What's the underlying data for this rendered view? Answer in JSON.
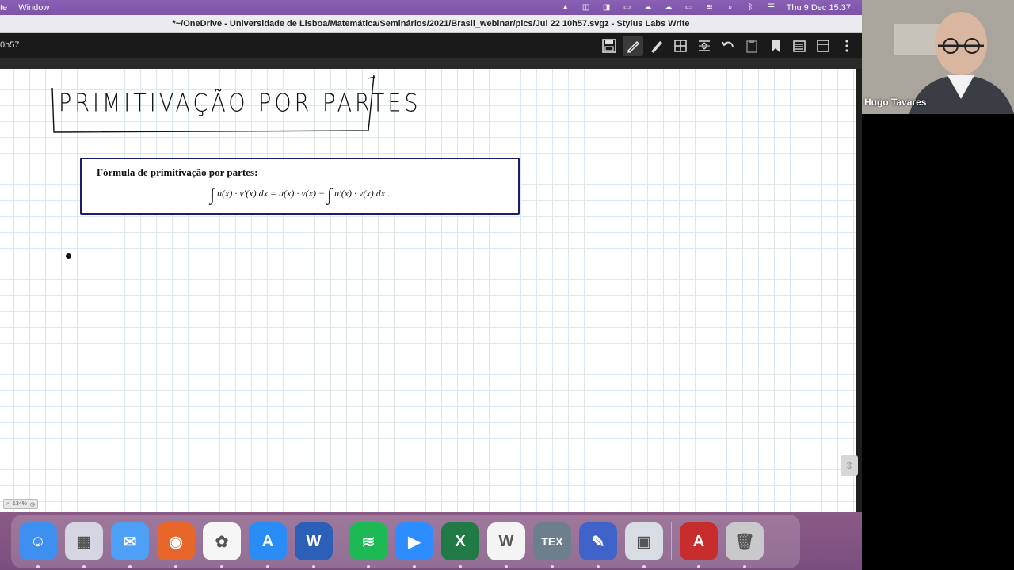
{
  "menubar": {
    "items": [
      "te",
      "Window"
    ],
    "clock": "Thu 9 Dec  15:37"
  },
  "window": {
    "title": "*~/OneDrive - Universidade de Lisboa/Matemática/Seminários/2021/Brasil_webinar/pics/Jul 22 10h57.svgz - Stylus Labs Write"
  },
  "toolbar": {
    "doc_label": "0h57",
    "tools": [
      "save-icon",
      "pen-icon",
      "highlighter-icon",
      "select-icon",
      "insert-space-icon",
      "undo-icon",
      "clipboard-icon",
      "bookmark-icon",
      "document-icon",
      "layout-icon",
      "more-icon"
    ]
  },
  "canvas": {
    "handwritten_title": "PRIMITIVAÇÃO POR PARTES",
    "formula_box": {
      "title": "Fórmula de primitivação por partes:",
      "eq_lhs": "u(x) · v′(x) dx = u(x) · v(x) −",
      "eq_rhs": "u′(x) · v(x) dx ."
    },
    "zoom": "134%"
  },
  "dock": {
    "apps": [
      {
        "name": "Finder",
        "color": "#3e8ff0",
        "glyph": "☺"
      },
      {
        "name": "Launchpad",
        "color": "#d6d6e2",
        "glyph": "▦"
      },
      {
        "name": "Mail",
        "color": "#4da0f5",
        "glyph": "✉"
      },
      {
        "name": "Firefox",
        "color": "#e8662a",
        "glyph": "◉"
      },
      {
        "name": "Photos",
        "color": "#f6f6f6",
        "glyph": "✿"
      },
      {
        "name": "App Store",
        "color": "#2a8cf5",
        "glyph": "A"
      },
      {
        "name": "Word",
        "color": "#2b5fb8",
        "glyph": "W"
      },
      {
        "name": "Spotify",
        "color": "#1db954",
        "glyph": "≋"
      },
      {
        "name": "Zoom",
        "color": "#2d8cff",
        "glyph": "▶"
      },
      {
        "name": "Excel",
        "color": "#1f7a45",
        "glyph": "X"
      },
      {
        "name": "Stylus Labs Write",
        "color": "#f4f4f4",
        "glyph": "W"
      },
      {
        "name": "TeXShop",
        "color": "#6d7f8c",
        "glyph": "TEX"
      },
      {
        "name": "Pencil",
        "color": "#3f63c9",
        "glyph": "✎"
      },
      {
        "name": "Preview",
        "color": "#d8dde4",
        "glyph": "▣"
      },
      {
        "name": "Acrobat",
        "color": "#c72d2d",
        "glyph": "A"
      },
      {
        "name": "Trash",
        "color": "#c9c9cc",
        "glyph": "🗑"
      }
    ]
  },
  "video": {
    "participant": "Hugo Tavares"
  }
}
